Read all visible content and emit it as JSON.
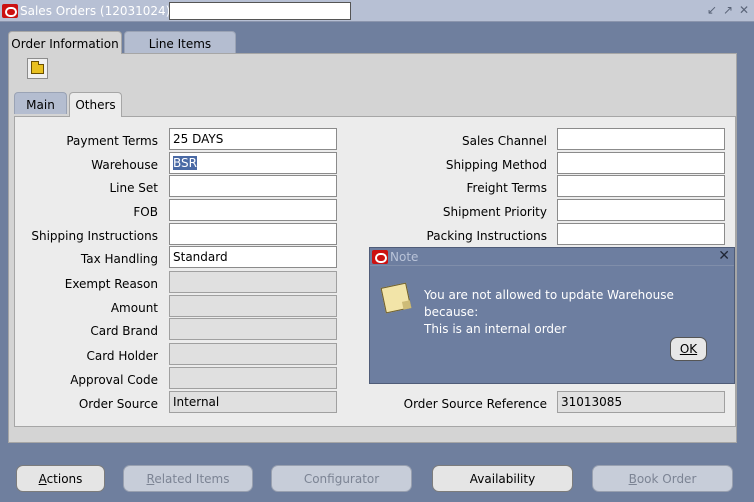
{
  "window": {
    "title": "Sales Orders (12031024) -",
    "title_field_value": "",
    "controls": [
      "↙",
      "↗",
      "✕"
    ]
  },
  "tabs_top": [
    {
      "label": "Order Information",
      "active": true
    },
    {
      "label": "Line Items",
      "active": false
    }
  ],
  "tabs_inner": [
    {
      "label": "Main",
      "active": false
    },
    {
      "label": "Others",
      "active": true
    }
  ],
  "icons": {
    "open": "folder-open-icon",
    "note": "note-icon"
  },
  "left_fields": [
    {
      "label": "Payment Terms",
      "value": "25 DAYS",
      "readonly": false
    },
    {
      "label": "Warehouse",
      "value": "BSR",
      "readonly": false,
      "selected": true
    },
    {
      "label": "Line Set",
      "value": "",
      "readonly": false
    },
    {
      "label": "FOB",
      "value": "",
      "readonly": false
    },
    {
      "label": "Shipping Instructions",
      "value": "",
      "readonly": false
    },
    {
      "label": "Tax Handling",
      "value": "Standard",
      "readonly": false
    },
    {
      "label": "Exempt Reason",
      "value": "",
      "readonly": true
    },
    {
      "label": "Amount",
      "value": "",
      "readonly": true
    },
    {
      "label": "Card Brand",
      "value": "",
      "readonly": true
    },
    {
      "label": "Card Holder",
      "value": "",
      "readonly": true
    },
    {
      "label": "Approval Code",
      "value": "",
      "readonly": true
    },
    {
      "label": "Order Source",
      "value": "Internal",
      "readonly": true
    }
  ],
  "right_fields": [
    {
      "label": "Sales Channel",
      "value": ""
    },
    {
      "label": "Shipping Method",
      "value": ""
    },
    {
      "label": "Freight Terms",
      "value": ""
    },
    {
      "label": "Shipment Priority",
      "value": ""
    },
    {
      "label": "Packing Instructions",
      "value": ""
    },
    {
      "label": "Order Source Reference",
      "value": "31013085",
      "readonly": true
    }
  ],
  "dialog": {
    "title": "Note",
    "message_line1": "You are not allowed to update Warehouse because:",
    "message_line2": "This is an internal order",
    "ok_label": "OK"
  },
  "buttons": [
    {
      "label": "Actions",
      "accel": "A",
      "rest": "ctions",
      "enabled": true
    },
    {
      "label": "Related Items",
      "accel": "R",
      "rest": "elated Items",
      "enabled": false
    },
    {
      "label": "Configurator",
      "accel": "",
      "rest": "Configurator",
      "enabled": false
    },
    {
      "label": "Availability",
      "accel": "",
      "rest": "Availability",
      "enabled": true
    },
    {
      "label": "Book Order",
      "accel": "B",
      "rest": "ook Order",
      "enabled": false
    }
  ],
  "colors": {
    "background": "#6f7f9e",
    "dialog": "#6d7ea0",
    "selection": "#4a6aa5",
    "logo": "#cc1111"
  }
}
